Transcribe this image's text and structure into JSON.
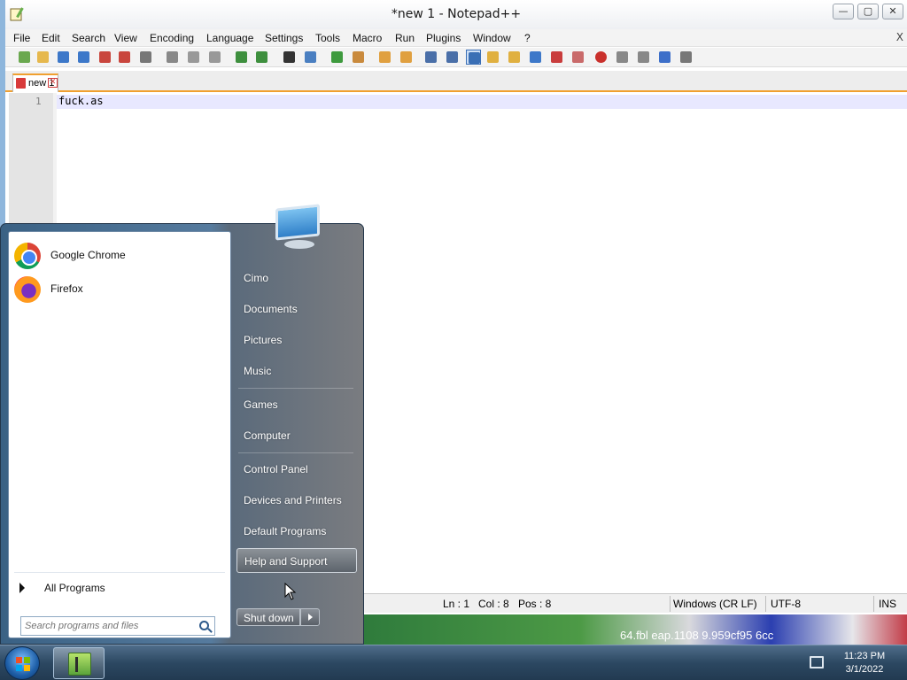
{
  "window": {
    "title": "*new 1 - Notepad++",
    "min_glyph": "—",
    "max_glyph": "▢",
    "close_glyph": "✕"
  },
  "menu": {
    "items": [
      "File",
      "Edit",
      "Search",
      "View",
      "Encoding",
      "Language",
      "Settings",
      "Tools",
      "Macro",
      "Run",
      "Plugins",
      "Window",
      "?"
    ],
    "close_glyph": "X"
  },
  "toolbar": {
    "icons": [
      "new-file-icon",
      "open-file-icon",
      "save-icon",
      "save-all-icon",
      "close-icon",
      "close-all-icon",
      "print-icon",
      "cut-icon",
      "copy-icon",
      "paste-icon",
      "undo-icon",
      "redo-icon",
      "find-icon",
      "replace-icon",
      "zoom-in-icon",
      "zoom-out-icon",
      "sync-vertical-icon",
      "sync-horizontal-icon",
      "word-wrap-icon",
      "show-all-chars-icon",
      "indent-guide-icon",
      "doc-map-icon",
      "function-list-icon",
      "folder-workspace-icon",
      "doc-list-icon",
      "monitoring-icon",
      "record-macro-icon",
      "stop-macro-icon",
      "play-macro-icon",
      "run-macro-multiple-icon",
      "save-macro-icon"
    ]
  },
  "tab": {
    "label": "new 1",
    "close_glyph": "✕"
  },
  "editor": {
    "line_number": "1",
    "content": "fuck.as"
  },
  "status": {
    "ln": "Ln : 1",
    "col": "Col : 8",
    "pos": "Pos : 8",
    "eol": "Windows (CR LF)",
    "encoding": "UTF-8",
    "mode": "INS"
  },
  "desktop": {
    "partial_text": "64.fbl  eap.1108  9.959cf95  6cc"
  },
  "start_menu": {
    "programs": [
      {
        "name": "Google Chrome",
        "icon": "chrome-icon"
      },
      {
        "name": "Firefox",
        "icon": "firefox-icon"
      }
    ],
    "all_programs": "All Programs",
    "search_placeholder": "Search programs and files",
    "right_items": {
      "user": "Cimo",
      "documents": "Documents",
      "pictures": "Pictures",
      "music": "Music",
      "games": "Games",
      "computer": "Computer",
      "control_panel": "Control Panel",
      "devices_printers": "Devices and Printers",
      "default_programs": "Default Programs",
      "help_support": "Help and Support"
    },
    "shutdown": "Shut down"
  },
  "taskbar": {
    "time": "11:23 PM",
    "date": "3/1/2022"
  },
  "colors": {
    "tab_accent": "#f0a030",
    "current_line": "#e8e8ff",
    "windows_flag": [
      "#f25022",
      "#7fba00",
      "#00a4ef",
      "#ffb900"
    ]
  }
}
